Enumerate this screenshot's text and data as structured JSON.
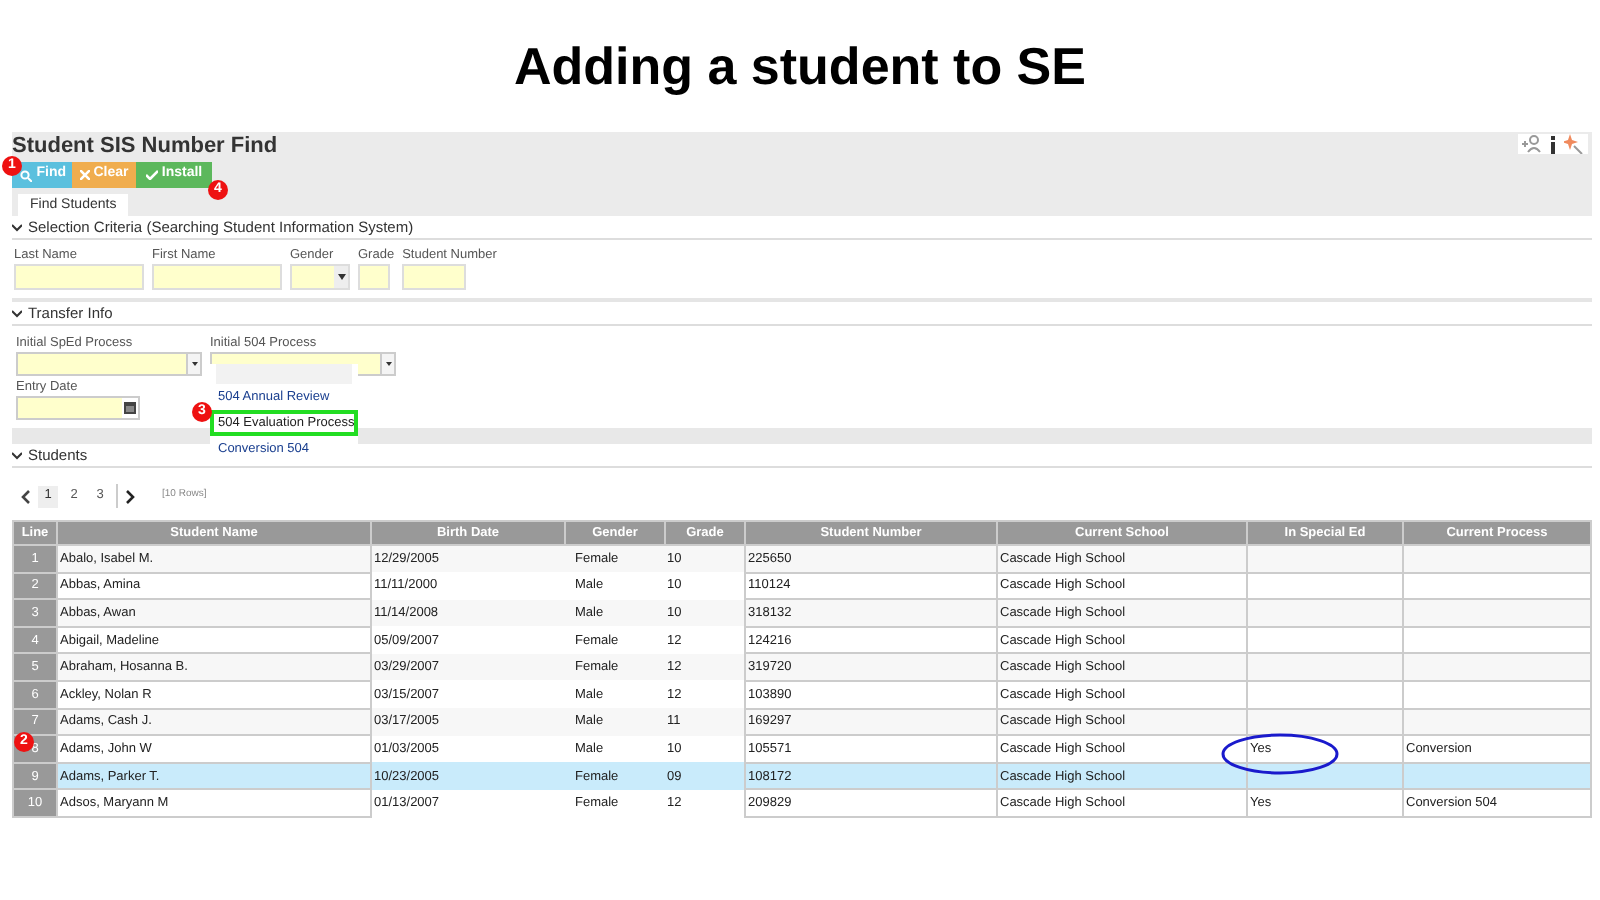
{
  "slide_title": "Adding a student to SE",
  "app": {
    "title": "Student SIS Number Find",
    "buttons": [
      {
        "label": "Find",
        "kind": "find"
      },
      {
        "label": "Clear",
        "kind": "clear"
      },
      {
        "label": "Install",
        "kind": "install"
      }
    ],
    "tabs": [
      {
        "label": "Find Students",
        "selected": true
      }
    ],
    "selection": {
      "heading": "Selection Criteria (Searching Student Information System)",
      "fields": [
        {
          "label": "Last Name",
          "kind": "text"
        },
        {
          "label": "First Name",
          "kind": "text"
        },
        {
          "label": "Gender",
          "kind": "select"
        },
        {
          "label": "Grade",
          "kind": "text"
        },
        {
          "label": "Student Number",
          "kind": "text"
        }
      ]
    },
    "transfer": {
      "heading": "Transfer Info",
      "fields": [
        {
          "label": "Initial SpEd Process"
        },
        {
          "label": "Initial 504 Process"
        }
      ],
      "date_field": {
        "label": "Entry Date"
      },
      "dropdown": [
        {
          "label": "504 Annual Review",
          "selected": false
        },
        {
          "label": "504 Evaluation Process",
          "selected": true
        },
        {
          "label": "Conversion 504",
          "selected": false
        }
      ]
    },
    "students": {
      "heading": "Students",
      "pages": [
        {
          "label": "1",
          "selected": true
        },
        {
          "label": "2",
          "selected": false
        },
        {
          "label": "3",
          "selected": false
        }
      ],
      "rows_label": "[10 Rows]",
      "columns": [
        "Line",
        "Student Name",
        "Birth Date",
        "Gender",
        "Grade",
        "Student Number",
        "Current School",
        "In Special Ed",
        "Current Process"
      ],
      "rows": [
        {
          "cells": [
            "1",
            "Abalo, Isabel M.",
            "12/29/2005",
            "Female",
            "10",
            "225650",
            "Cascade High School",
            "",
            ""
          ],
          "selected": false
        },
        {
          "cells": [
            "2",
            "Abbas, Amina",
            "11/11/2000",
            "Male",
            "10",
            "110124",
            "Cascade High School",
            "",
            ""
          ],
          "selected": false
        },
        {
          "cells": [
            "3",
            "Abbas, Awan",
            "11/14/2008",
            "Male",
            "10",
            "318132",
            "Cascade High School",
            "",
            ""
          ],
          "selected": false
        },
        {
          "cells": [
            "4",
            "Abigail, Madeline",
            "05/09/2007",
            "Female",
            "12",
            "124216",
            "Cascade High School",
            "",
            ""
          ],
          "selected": false
        },
        {
          "cells": [
            "5",
            "Abraham, Hosanna B.",
            "03/29/2007",
            "Female",
            "12",
            "319720",
            "Cascade High School",
            "",
            ""
          ],
          "selected": false
        },
        {
          "cells": [
            "6",
            "Ackley, Nolan R",
            "03/15/2007",
            "Male",
            "12",
            "103890",
            "Cascade High School",
            "",
            ""
          ],
          "selected": false
        },
        {
          "cells": [
            "7",
            "Adams, Cash J.",
            "03/17/2005",
            "Male",
            "11",
            "169297",
            "Cascade High School",
            "",
            ""
          ],
          "selected": false
        },
        {
          "cells": [
            "8",
            "Adams, John W",
            "01/03/2005",
            "Male",
            "10",
            "105571",
            "Cascade High School",
            "Yes",
            "Conversion"
          ],
          "selected": false
        },
        {
          "cells": [
            "9",
            "Adams, Parker T.",
            "10/23/2005",
            "Female",
            "09",
            "108172",
            "Cascade High School",
            "",
            ""
          ],
          "selected": true
        },
        {
          "cells": [
            "10",
            "Adsos, Maryann M",
            "01/13/2007",
            "Female",
            "12",
            "209829",
            "Cascade High School",
            "Yes",
            "Conversion 504"
          ],
          "selected": false
        }
      ]
    }
  },
  "callouts": [
    {
      "label": "1",
      "kind": "find"
    },
    {
      "label": "4",
      "kind": "install"
    },
    {
      "label": "3",
      "kind": "dropdown"
    },
    {
      "label": "2",
      "kind": "row"
    }
  ]
}
